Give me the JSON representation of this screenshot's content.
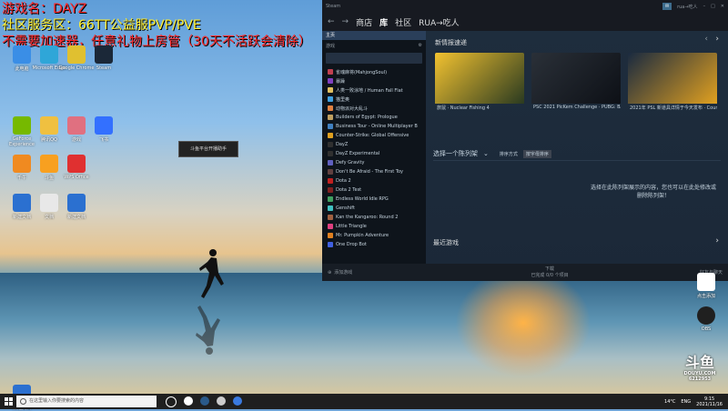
{
  "overlay": {
    "line1": "游戏名：DAYZ",
    "line2": "社区服务区：66TT公益服PVP/PVE",
    "line3": "不需要加速器，任意礼物上房管（30天不活跃会清除）"
  },
  "desktop": {
    "icons": [
      {
        "label": "此电脑",
        "color": "#3a8ee6"
      },
      {
        "label": "Microsoft Edge",
        "color": "#2fa6d8"
      },
      {
        "label": "Google Chrome",
        "color": "#e0c030"
      },
      {
        "label": "Steam",
        "color": "#1b2838"
      },
      {
        "label": "GeForce Experience",
        "color": "#76b900"
      },
      {
        "label": "腾讯QQ",
        "color": "#f0c040"
      },
      {
        "label": "游戏",
        "color": "#e07080"
      },
      {
        "label": "飞书",
        "color": "#3370ff"
      },
      {
        "label": "千牛",
        "color": "#f08a20"
      },
      {
        "label": "斗鱼",
        "color": "#f8a020"
      },
      {
        "label": "WPS Office",
        "color": "#e03030"
      },
      {
        "label": "新建文档",
        "color": "#2b70d0"
      },
      {
        "label": "文档",
        "color": "#e8e8e8"
      },
      {
        "label": "新建文档",
        "color": "#2b70d0"
      },
      {
        "label": "新建文档",
        "color": "#2b70d0"
      }
    ],
    "popup": "斗鱼平台开播助手"
  },
  "steam": {
    "titlebar": {
      "menu": "Steam",
      "user": "rua→吃人"
    },
    "nav": {
      "back": "←",
      "forward": "→",
      "store": "商店",
      "library": "库",
      "community": "社区",
      "user": "RUA→吃人"
    },
    "left": {
      "home": "主页",
      "games_label": "游戏",
      "games": [
        {
          "name": "雀魂麻将(MahjongSoul)",
          "color": "#c04050"
        },
        {
          "name": "暴躁",
          "color": "#8040c0"
        },
        {
          "name": "人类一败涂地 / Human Fall Flat",
          "color": "#e0c060"
        },
        {
          "name": "猫里奥",
          "color": "#40a0e0"
        },
        {
          "name": "动物派对大乱斗",
          "color": "#e08040"
        },
        {
          "name": "Builders of Egypt: Prologue",
          "color": "#c0a060"
        },
        {
          "name": "Business Tour - Online Multiplayer B",
          "color": "#4080c0"
        },
        {
          "name": "Counter-Strike: Global Offensive",
          "color": "#e0a020"
        },
        {
          "name": "DayZ",
          "color": "#303030"
        },
        {
          "name": "DayZ Experimental",
          "color": "#303030"
        },
        {
          "name": "Defy Gravity",
          "color": "#6060c0"
        },
        {
          "name": "Don't Be Afraid - The First Toy",
          "color": "#604040"
        },
        {
          "name": "Dota 2",
          "color": "#c02020"
        },
        {
          "name": "Dota 2 Test",
          "color": "#802020"
        },
        {
          "name": "Endless World Idle RPG",
          "color": "#40a060"
        },
        {
          "name": "Genshift",
          "color": "#40c0c0"
        },
        {
          "name": "Kan the Kangaroo: Round 2",
          "color": "#a06040"
        },
        {
          "name": "Little Triangle",
          "color": "#e04080"
        },
        {
          "name": "Mr. Pumpkin Adventure",
          "color": "#e08020"
        },
        {
          "name": "One Drop Bot",
          "color": "#4060e0"
        }
      ]
    },
    "main": {
      "news_title": "新情报速递",
      "news": [
        {
          "caption": "旅鼠 · Nuclear Fishing 4",
          "c1": "#f2c230",
          "c2": "#2a3a20"
        },
        {
          "caption": "PSC 2021 PicKem Challenge · PUBG: BATTLEGROUNDS",
          "c1": "#2a3038",
          "c2": "#0d1016"
        },
        {
          "caption": "2021年 PSL 新道具详情于今天发布 · Counter-Strike: Global Offensive",
          "c1": "#1a2a40",
          "c2": "#e0a020"
        }
      ],
      "shelf_select": "选择一个陈列架",
      "sort_label": "排序方式",
      "sort_value": "按字母排序",
      "shelf_hint": "选择在此陈列架展示的内容，您也可以在此处修改或删除陈列架！",
      "recent": "最近游戏"
    },
    "footer": {
      "add_game": "添加游戏",
      "downloads": "下载",
      "downloads_sub": "已完成 0/0 个项目",
      "friends": "好友与聊天"
    }
  },
  "widgets": {
    "w1": "点击添加",
    "w2": "OBS",
    "douyu_num": "6212953",
    "douyu_brand": "斗鱼",
    "douyu_sub": "DOUYU.COM"
  },
  "taskbar": {
    "search_placeholder": "在这里输入你要搜索的内容",
    "temperature": "14°C",
    "lang": "ENG",
    "time": "9:15",
    "date": "2021/11/16"
  }
}
